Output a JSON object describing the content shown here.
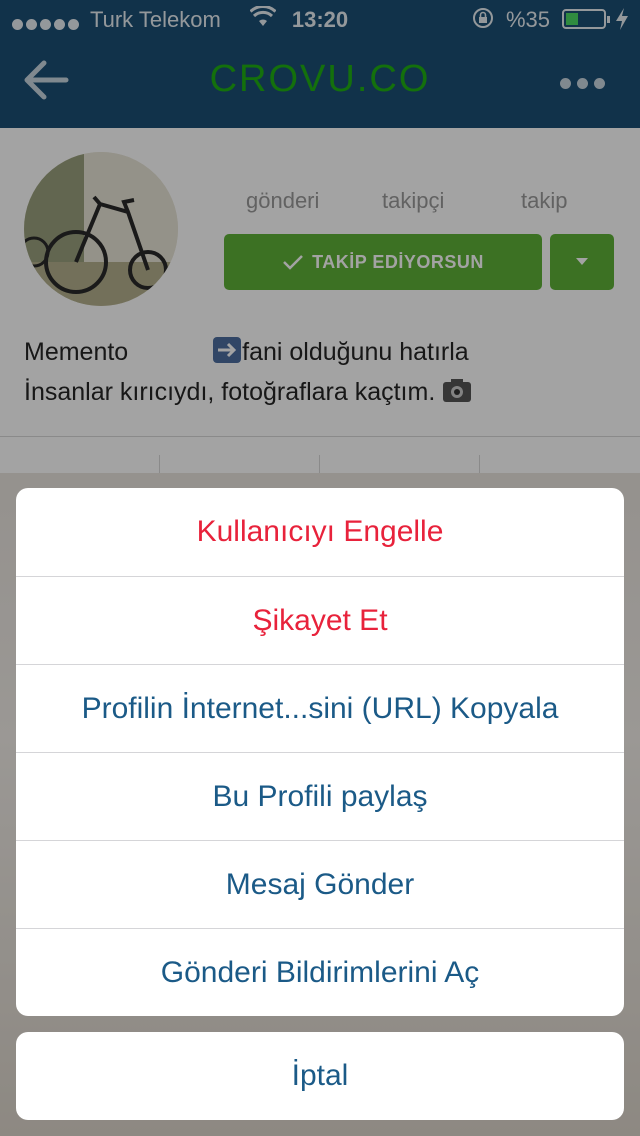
{
  "status_bar": {
    "carrier": "Turk Telekom",
    "time": "13:20",
    "battery_text": "%35",
    "battery_level": 0.35,
    "icons": [
      "signal-dots-icon",
      "wifi-icon",
      "rotation-lock-icon",
      "battery-icon",
      "charging-bolt-icon"
    ]
  },
  "nav": {
    "title": "CROVU.CO",
    "title_color": "#20b014",
    "bar_color": "#1b4f74",
    "back_icon": "back-arrow-icon",
    "more_icon": "more-dots-icon"
  },
  "profile": {
    "stats": [
      "gönderi",
      "takipçi",
      "takip"
    ],
    "follow_button": "TAKİP EDİYORSUN",
    "follow_color": "#5fb137",
    "bio_line1_a": "Memento",
    "bio_line1_b": "fani olduğunu hatırla",
    "bio_line2": "İnsanlar kırıcıydı, fotoğraflara kaçtım."
  },
  "action_sheet": {
    "actions": [
      {
        "label": "Kullanıcıyı Engelle",
        "style": "destructive"
      },
      {
        "label": "Şikayet Et",
        "style": "destructive"
      },
      {
        "label": "Profilin İnternet...sini (URL) Kopyala",
        "style": "default"
      },
      {
        "label": "Bu Profili paylaş",
        "style": "default"
      },
      {
        "label": "Mesaj Gönder",
        "style": "default"
      },
      {
        "label": "Gönderi Bildirimlerini Aç",
        "style": "default"
      }
    ],
    "cancel": "İptal",
    "destructive_color": "#e8223b",
    "default_color": "#1b5a87"
  }
}
